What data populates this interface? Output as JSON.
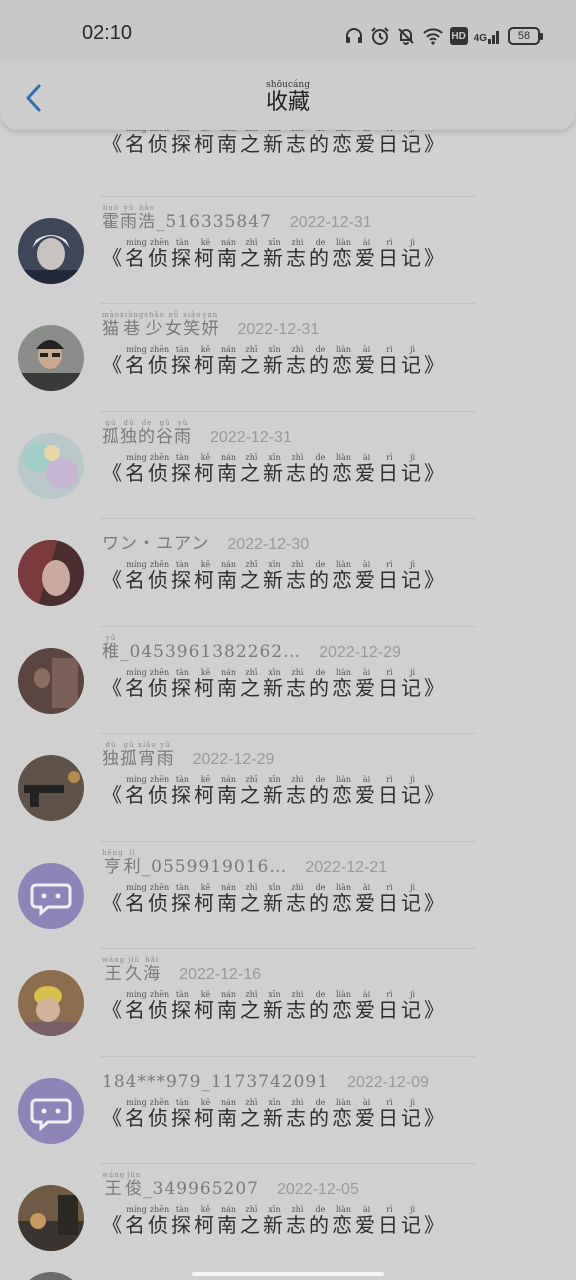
{
  "status_bar": {
    "time": "02:10",
    "net_label": "4G",
    "hd_label": "HD",
    "battery": "58",
    "icons": [
      "headphones-icon",
      "alarm-icon",
      "mute-bell-icon",
      "wifi-icon",
      "hd-icon",
      "cellular-4g-icon",
      "battery-icon"
    ]
  },
  "navbar": {
    "back_icon": "chevron-left-icon",
    "title_chars": [
      {
        "char": "收",
        "pinyin": "shōu"
      },
      {
        "char": "藏",
        "pinyin": "cáng"
      }
    ]
  },
  "book_title": {
    "open": "《",
    "close": "》",
    "chars": [
      {
        "char": "名",
        "pinyin": "míng"
      },
      {
        "char": "侦",
        "pinyin": "zhēn"
      },
      {
        "char": "探",
        "pinyin": "tàn"
      },
      {
        "char": "柯",
        "pinyin": "kē"
      },
      {
        "char": "南",
        "pinyin": "nán"
      },
      {
        "char": "之",
        "pinyin": "zhī"
      },
      {
        "char": "新",
        "pinyin": "xīn"
      },
      {
        "char": "志",
        "pinyin": "zhì"
      },
      {
        "char": "的",
        "pinyin": "de"
      },
      {
        "char": "恋",
        "pinyin": "liàn"
      },
      {
        "char": "爱",
        "pinyin": "ài"
      },
      {
        "char": "日",
        "pinyin": "rì"
      },
      {
        "char": "记",
        "pinyin": "jì"
      }
    ]
  },
  "favorites": [
    {
      "user": "",
      "date": "",
      "avatar": "partial",
      "partial": true
    },
    {
      "user": [
        {
          "c": "霍",
          "p": "huò"
        },
        {
          "c": "雨",
          "p": "yǔ"
        },
        {
          "c": "浩",
          "p": "hào"
        },
        {
          "c": "_516335847",
          "p": ""
        }
      ],
      "date": "2022-12-31",
      "avatar": "dark-hair"
    },
    {
      "user": [
        {
          "c": "猫",
          "p": "māo"
        },
        {
          "c": "巷",
          "p": "xiàng"
        },
        {
          "c": "少",
          "p": "shǎo"
        },
        {
          "c": "女",
          "p": "nǚ"
        },
        {
          "c": "笑",
          "p": "xiào"
        },
        {
          "c": "妍",
          "p": "yán"
        }
      ],
      "date": "2022-12-31",
      "avatar": "boy-glasses"
    },
    {
      "user": [
        {
          "c": "孤",
          "p": "gū"
        },
        {
          "c": "独",
          "p": "dú"
        },
        {
          "c": "的",
          "p": "de"
        },
        {
          "c": "谷",
          "p": "gǔ"
        },
        {
          "c": "雨",
          "p": "yǔ"
        }
      ],
      "date": "2022-12-31",
      "avatar": "pastel"
    },
    {
      "user": [
        {
          "c": "ワン・ユアン",
          "p": ""
        }
      ],
      "date": "2022-12-30",
      "avatar": "red-hair"
    },
    {
      "user": [
        {
          "c": "稚",
          "p": "yǔ"
        },
        {
          "c": "_0453961382262…",
          "p": ""
        }
      ],
      "date": "2022-12-29",
      "avatar": "brown"
    },
    {
      "user": [
        {
          "c": "独",
          "p": "dú"
        },
        {
          "c": "孤",
          "p": "gū"
        },
        {
          "c": "宵",
          "p": "xiāo"
        },
        {
          "c": "雨",
          "p": "yǔ"
        }
      ],
      "date": "2022-12-29",
      "avatar": "gun"
    },
    {
      "user": [
        {
          "c": "亨",
          "p": "hēng"
        },
        {
          "c": "利",
          "p": "lì"
        },
        {
          "c": "_0559919016…",
          "p": ""
        }
      ],
      "date": "2022-12-21",
      "avatar": "chat-default"
    },
    {
      "user": [
        {
          "c": "王",
          "p": "wáng"
        },
        {
          "c": "久",
          "p": "jiǔ"
        },
        {
          "c": "海",
          "p": "hǎi"
        }
      ],
      "date": "2022-12-16",
      "avatar": "baby-yellow"
    },
    {
      "user": [
        {
          "c": "184***979_1173742091",
          "p": ""
        }
      ],
      "date": "2022-12-09",
      "avatar": "chat-default"
    },
    {
      "user": [
        {
          "c": "王",
          "p": "wáng"
        },
        {
          "c": "俊",
          "p": "jùn"
        },
        {
          "c": "_349965207",
          "p": ""
        }
      ],
      "date": "2022-12-05",
      "avatar": "sunset"
    }
  ],
  "colors": {
    "accent_back": "#2f6fb3",
    "chat_avatar_bg": "#8f84b8",
    "overlay_bg": "#d0d0d0"
  }
}
